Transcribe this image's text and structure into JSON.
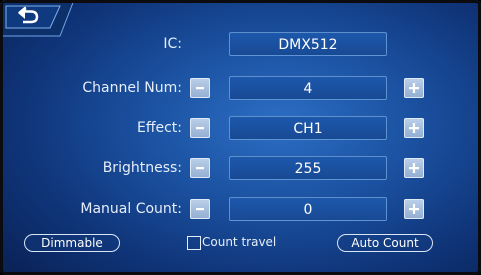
{
  "colors": {
    "background": "#1a4f9e",
    "field_border": "#96c8fa",
    "button": "#a8c0df",
    "text": "#ffffff"
  },
  "back": {
    "icon": "back-arrow-icon"
  },
  "rows": [
    {
      "label": "IC:",
      "value": "DMX512",
      "has_stepper": false
    },
    {
      "label": "Channel Num:",
      "value": "4",
      "has_stepper": true
    },
    {
      "label": "Effect:",
      "value": "CH1",
      "has_stepper": true
    },
    {
      "label": "Brightness:",
      "value": "255",
      "has_stepper": true
    },
    {
      "label": "Manual Count:",
      "value": "0",
      "has_stepper": true
    }
  ],
  "bottom": {
    "dimmable_label": "Dimmable",
    "count_travel_label": "Count travel",
    "count_travel_checked": false,
    "auto_count_label": "Auto Count"
  }
}
